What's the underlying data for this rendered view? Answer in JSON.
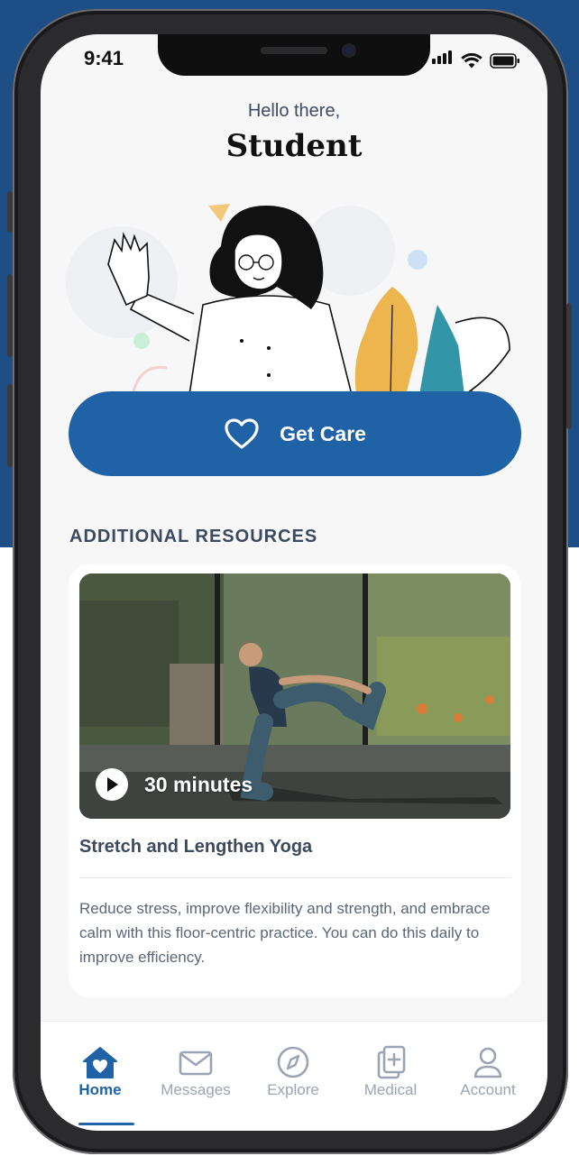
{
  "status_bar": {
    "time": "9:41"
  },
  "header": {
    "greeting": "Hello there,",
    "name": "Student"
  },
  "cta": {
    "label": "Get Care",
    "icon": "heart-icon"
  },
  "resources": {
    "section_title": "ADDITIONAL RESOURCES",
    "card": {
      "duration": "30 minutes",
      "title": "Stretch and Lengthen Yoga",
      "description": "Reduce stress, improve flexibility and strength, and embrace calm with this floor-centric practice. You can do this daily to improve efficiency."
    }
  },
  "tabbar": {
    "items": [
      {
        "label": "Home",
        "icon": "home-heart-icon",
        "active": true
      },
      {
        "label": "Messages",
        "icon": "mail-icon",
        "active": false
      },
      {
        "label": "Explore",
        "icon": "compass-icon",
        "active": false
      },
      {
        "label": "Medical",
        "icon": "medical-records-icon",
        "active": false
      },
      {
        "label": "Account",
        "icon": "user-icon",
        "active": false
      }
    ]
  },
  "colors": {
    "primary": "#1f62a6",
    "background": "#1d4f86",
    "inactive": "#9aa4b3",
    "text_heading": "#3b4a5e"
  }
}
